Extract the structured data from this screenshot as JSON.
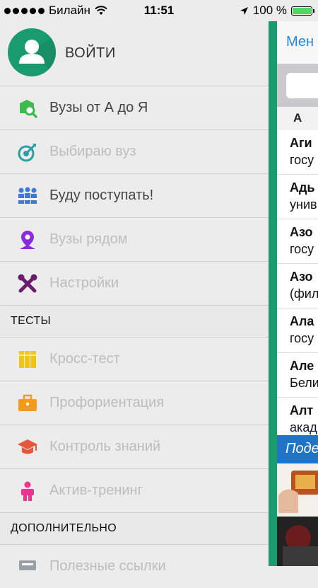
{
  "status": {
    "carrier": "Билайн",
    "time": "11:51",
    "battery": "100 %",
    "battery_level": 1.0
  },
  "profile": {
    "login_label": "ВОЙТИ"
  },
  "menu": {
    "main_items": [
      {
        "label": "Вузы от А до Я",
        "icon": "search-university-icon",
        "color": "#3dbb4e",
        "enabled": true
      },
      {
        "label": "Выбираю вуз",
        "icon": "target-icon",
        "color": "#27a0a5",
        "enabled": false
      },
      {
        "label": "Буду поступать!",
        "icon": "people-icon",
        "color": "#3f7bd6",
        "enabled": true
      },
      {
        "label": "Вузы рядом",
        "icon": "location-pin-icon",
        "color": "#8a2be2",
        "enabled": false
      },
      {
        "label": "Настройки",
        "icon": "tools-icon",
        "color": "#6a1b6e",
        "enabled": false
      }
    ],
    "tests_title": "ТЕСТЫ",
    "test_items": [
      {
        "label": "Кросс-тест",
        "icon": "books-icon",
        "color": "#f0c419",
        "enabled": false
      },
      {
        "label": "Профориентация",
        "icon": "briefcase-icon",
        "color": "#f59a1b",
        "enabled": false
      },
      {
        "label": "Контроль знаний",
        "icon": "graduation-cap-icon",
        "color": "#e8553a",
        "enabled": false
      },
      {
        "label": "Актив-тренинг",
        "icon": "person-icon",
        "color": "#e8368f",
        "enabled": false
      }
    ],
    "extra_title": "ДОПОЛНИТЕЛЬНО",
    "extra_items": [
      {
        "label": "Полезные ссылки",
        "icon": "links-icon",
        "color": "#9aa0a6",
        "enabled": false
      }
    ]
  },
  "content": {
    "back_label": "Мен",
    "section_letter": "А",
    "rows": [
      {
        "title": "Аги",
        "subtitle": "госу"
      },
      {
        "title": "Адь",
        "subtitle": "унив"
      },
      {
        "title": "Азо",
        "subtitle": "госу"
      },
      {
        "title": "Азо",
        "subtitle": "(фил"
      },
      {
        "title": "Ала",
        "subtitle": "госу"
      },
      {
        "title": "Але",
        "subtitle": "Бели"
      },
      {
        "title": "Алт",
        "subtitle": "акад"
      }
    ],
    "banner_text": "Поде"
  },
  "colors": {
    "accent_green": "#1a9b6f",
    "link_blue": "#1e88e5"
  }
}
